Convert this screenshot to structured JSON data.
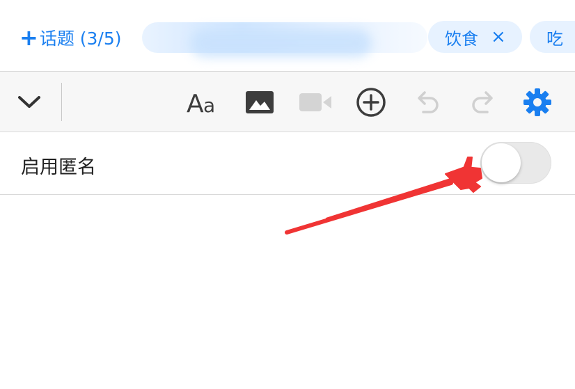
{
  "topics": {
    "add_label": "话题 (3/5)",
    "tags": [
      {
        "label": "饮食",
        "remove": "×"
      },
      {
        "label": "吃"
      }
    ]
  },
  "toolbar": {
    "icons": [
      "chevron-down-icon",
      "font-size-icon",
      "image-icon",
      "video-icon",
      "add-circle-icon",
      "undo-icon",
      "redo-icon",
      "settings-icon"
    ],
    "accent_color": "#1a7ff0"
  },
  "settings": {
    "anonymous_label": "启用匿名",
    "anonymous_enabled": false
  },
  "annotation": {
    "arrow_color": "#f03434"
  }
}
